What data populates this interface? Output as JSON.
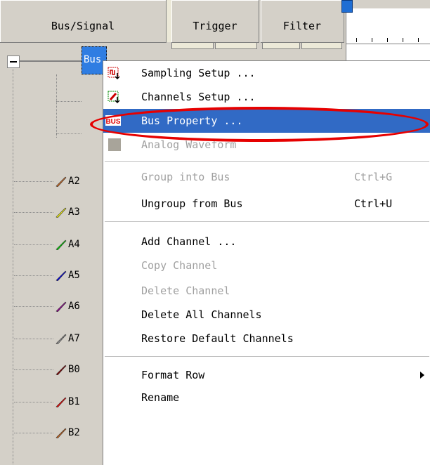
{
  "header": {
    "bus_signal": "Bus/Signal",
    "trigger": "Trigger",
    "filter": "Filter"
  },
  "tree": {
    "bus_label": "Bus",
    "channels": [
      {
        "label": "A2",
        "color": "#d2691e"
      },
      {
        "label": "A3",
        "color": "#ffff00"
      },
      {
        "label": "A4",
        "color": "#00dd00"
      },
      {
        "label": "A5",
        "color": "#0000ee"
      },
      {
        "label": "A6",
        "color": "#990099"
      },
      {
        "label": "A7",
        "color": "#999999"
      },
      {
        "label": "B0",
        "color": "#8b0000"
      },
      {
        "label": "B1",
        "color": "#ff0000"
      },
      {
        "label": "B2",
        "color": "#d2691e"
      }
    ]
  },
  "menu": {
    "items": [
      {
        "label": "Sampling Setup ...",
        "icon": "sampling-setup-icon"
      },
      {
        "label": "Channels Setup ...",
        "icon": "channels-setup-icon"
      },
      {
        "label": "Bus Property ...",
        "icon": "bus-icon",
        "icon_text": "BUS",
        "highlighted": true
      },
      {
        "label": "Analog Waveform",
        "icon": "analog-waveform-icon",
        "disabled": true
      },
      {
        "label": "Group into Bus",
        "shortcut": "Ctrl+G",
        "disabled": true
      },
      {
        "label": "Ungroup from Bus",
        "shortcut": "Ctrl+U"
      },
      {
        "label": "Add Channel ..."
      },
      {
        "label": "Copy Channel",
        "disabled": true
      },
      {
        "label": "Delete Channel",
        "disabled": true
      },
      {
        "label": "Delete All Channels"
      },
      {
        "label": "Restore Default Channels"
      },
      {
        "label": "Format Row",
        "submenu": true
      },
      {
        "label": "Rename"
      }
    ]
  },
  "colors": {
    "highlight": "#316ac5",
    "callout": "#e60000",
    "disabled_text": "#a0a0a0"
  }
}
